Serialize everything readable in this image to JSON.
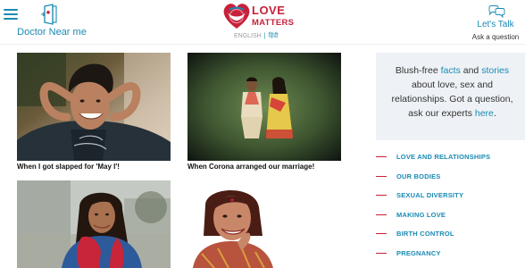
{
  "header": {
    "doctor_label": "Doctor Near me",
    "logo_line1": "LOVE",
    "logo_line2": "MATTERS",
    "lang_english": "ENGLISH",
    "lang_separator": "|",
    "lang_hindi": "हिंदी",
    "talk_label": "Let's Talk",
    "talk_sub": "Ask a question"
  },
  "cards": [
    {
      "caption": "When I got slapped for 'May I'!"
    },
    {
      "caption": "When Corona arranged our marriage!"
    },
    {
      "caption": ""
    },
    {
      "caption": ""
    }
  ],
  "sidebar": {
    "blurb": {
      "p1": "Blush-free ",
      "link_facts": "facts",
      "p2": " and ",
      "link_stories": "stories",
      "p3": " about love, sex and relationships. Got a question, ask our experts ",
      "link_here": "here",
      "p4": "."
    },
    "topics": [
      {
        "label": "LOVE AND RELATIONSHIPS"
      },
      {
        "label": "OUR BODIES"
      },
      {
        "label": "SEXUAL DIVERSITY"
      },
      {
        "label": "MAKING LOVE"
      },
      {
        "label": "BIRTH CONTROL"
      },
      {
        "label": "PREGNANCY"
      }
    ]
  },
  "colors": {
    "accent_blue": "#1a8ab3",
    "brand_red": "#c8213a",
    "panel_bg": "#eef2f6"
  }
}
